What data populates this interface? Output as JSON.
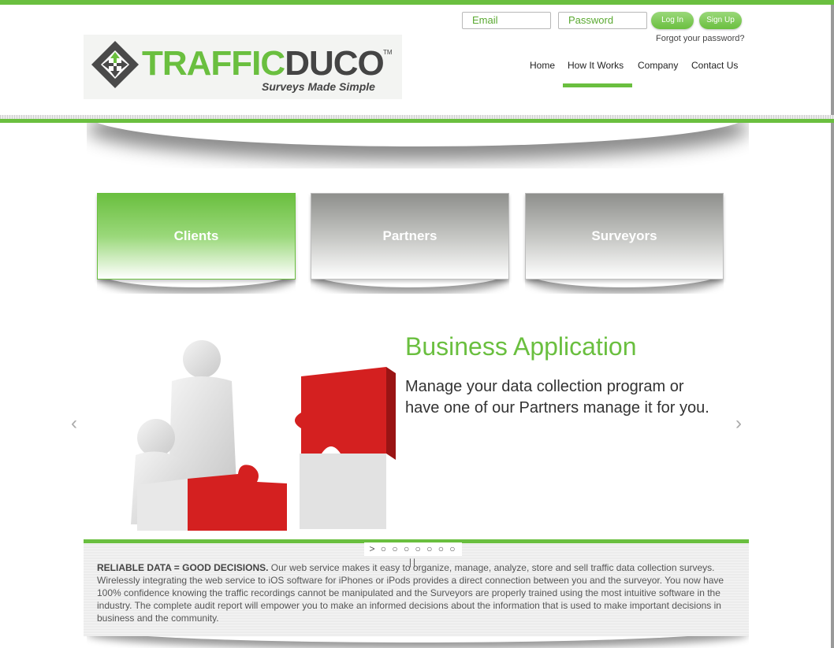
{
  "login": {
    "email_placeholder": "Email",
    "password_placeholder": "Password",
    "login_label": "Log In",
    "signup_label": "Sign Up",
    "forgot_label": "Forgot your password?"
  },
  "logo": {
    "word_green": "TRAFFIC",
    "word_dark": "DUCO",
    "tm": "TM",
    "tagline": "Surveys Made Simple"
  },
  "nav": {
    "items": [
      "Home",
      "How It Works",
      "Company",
      "Contact Us"
    ],
    "active": "How It Works"
  },
  "tiles": [
    "Clients",
    "Partners",
    "Surveyors"
  ],
  "slider": {
    "title": "Business Application",
    "text": "Manage your data collection program or have one of our Partners manage it for you.",
    "prev_icon": "‹",
    "next_icon": "›",
    "pager": "> ○ ○ ○ ○ ○ ○ ○ ||"
  },
  "intro": {
    "lead": "RELIABLE DATA = GOOD DECISIONS.",
    "body": " Our web service makes it easy to organize, manage, analyze, store and sell traffic data collection surveys. Wirelessly integrating the web service to iOS software for iPhones or iPods provides a direct connection between you and the surveyor. You now have 100% confidence knowing the traffic recordings cannot be manipulated and the Surveyors are properly trained using the most intuitive software in the industry. The complete audit report will empower you to make an informed decisions about the information that is used to make important decisions in business and the community."
  },
  "colors": {
    "accent_green": "#6abf3f",
    "puzzle_red": "#d42020",
    "text_dark": "#333333"
  },
  "icons": {
    "logo": "arrows-converging-diamond-icon",
    "prev": "chevron-left-icon",
    "next": "chevron-right-icon"
  }
}
